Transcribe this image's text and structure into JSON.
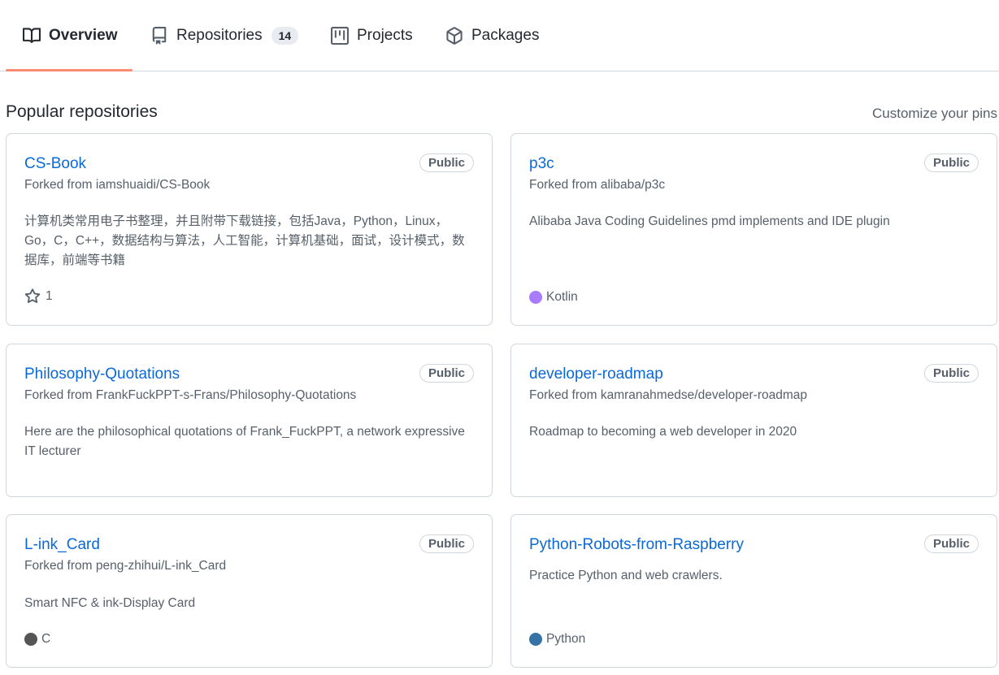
{
  "tabs": [
    {
      "label": "Overview",
      "icon": "book-icon",
      "selected": true
    },
    {
      "label": "Repositories",
      "icon": "repo-icon",
      "count": "14"
    },
    {
      "label": "Projects",
      "icon": "project-icon"
    },
    {
      "label": "Packages",
      "icon": "package-icon"
    }
  ],
  "section": {
    "title": "Popular repositories",
    "customize_label": "Customize your pins"
  },
  "repos": [
    {
      "name": "CS-Book",
      "visibility": "Public",
      "fork_text": "Forked from iamshuaidi/CS-Book",
      "description": "计算机类常用电子书整理，并且附带下载链接，包括Java，Python，Linux，Go，C，C++，数据结构与算法，人工智能，计算机基础，面试，设计模式，数据库，前端等书籍",
      "stars": "1"
    },
    {
      "name": "p3c",
      "visibility": "Public",
      "fork_text": "Forked from alibaba/p3c",
      "description": "Alibaba Java Coding Guidelines pmd implements and IDE plugin",
      "language": "Kotlin",
      "language_color": "#A97BFF"
    },
    {
      "name": "Philosophy-Quotations",
      "visibility": "Public",
      "fork_text": "Forked from FrankFuckPPT-s-Frans/Philosophy-Quotations",
      "description": "Here are the philosophical quotations of Frank_FuckPPT, a network expressive IT lecturer"
    },
    {
      "name": "developer-roadmap",
      "visibility": "Public",
      "fork_text": "Forked from kamranahmedse/developer-roadmap",
      "description": "Roadmap to becoming a web developer in 2020"
    },
    {
      "name": "L-ink_Card",
      "visibility": "Public",
      "fork_text": "Forked from peng-zhihui/L-ink_Card",
      "description": "Smart NFC & ink-Display Card",
      "language": "C",
      "language_color": "#555555"
    },
    {
      "name": "Python-Robots-from-Raspberry",
      "visibility": "Public",
      "description": "Practice Python and web crawlers.",
      "language": "Python",
      "language_color": "#3572A5"
    }
  ]
}
